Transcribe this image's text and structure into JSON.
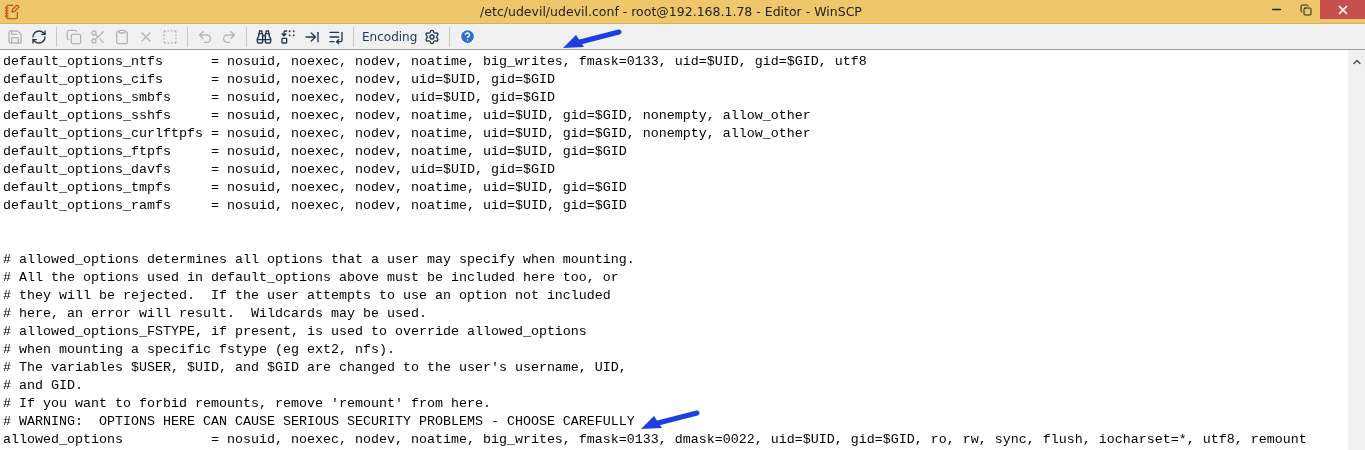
{
  "window": {
    "title": "/etc/udevil/udevil.conf - root@192.168.1.78 - Editor - WinSCP"
  },
  "toolbar": [
    {
      "kind": "save",
      "disabled": true
    },
    {
      "kind": "reload",
      "disabled": false
    },
    {
      "kind": "separator"
    },
    {
      "kind": "copy",
      "disabled": true
    },
    {
      "kind": "cut",
      "disabled": true
    },
    {
      "kind": "paste",
      "disabled": true
    },
    {
      "kind": "delete",
      "disabled": true
    },
    {
      "kind": "select_all",
      "disabled": true
    },
    {
      "kind": "separator"
    },
    {
      "kind": "undo",
      "disabled": true
    },
    {
      "kind": "redo",
      "disabled": true
    },
    {
      "kind": "separator"
    },
    {
      "kind": "find",
      "disabled": false
    },
    {
      "kind": "replace",
      "disabled": false
    },
    {
      "kind": "find_next",
      "disabled": false
    },
    {
      "kind": "goto_line",
      "disabled": false
    },
    {
      "kind": "separator"
    },
    {
      "kind": "text",
      "label": "Encoding",
      "disabled": false
    },
    {
      "kind": "settings",
      "disabled": false
    },
    {
      "kind": "separator"
    },
    {
      "kind": "help",
      "disabled": false
    }
  ],
  "editor": {
    "lines": [
      {
        "kind": "code",
        "text": "default_options_ntfs      = nosuid, noexec, nodev, noatime, big_writes, fmask=0133, uid=$UID, gid=$GID, utf8"
      },
      {
        "kind": "code",
        "text": "default_options_cifs      = nosuid, noexec, nodev, uid=$UID, gid=$GID"
      },
      {
        "kind": "code",
        "text": "default_options_smbfs     = nosuid, noexec, nodev, uid=$UID, gid=$GID"
      },
      {
        "kind": "code",
        "text": "default_options_sshfs     = nosuid, noexec, nodev, noatime, uid=$UID, gid=$GID, nonempty, allow_other"
      },
      {
        "kind": "code",
        "text": "default_options_curlftpfs = nosuid, noexec, nodev, noatime, uid=$UID, gid=$GID, nonempty, allow_other"
      },
      {
        "kind": "code",
        "text": "default_options_ftpfs     = nosuid, noexec, nodev, noatime, uid=$UID, gid=$GID"
      },
      {
        "kind": "code",
        "text": "default_options_davfs     = nosuid, noexec, nodev, uid=$UID, gid=$GID"
      },
      {
        "kind": "code",
        "text": "default_options_tmpfs     = nosuid, noexec, nodev, noatime, uid=$UID, gid=$GID"
      },
      {
        "kind": "code",
        "text": "default_options_ramfs     = nosuid, noexec, nodev, noatime, uid=$UID, gid=$GID"
      },
      {
        "kind": "blank"
      },
      {
        "kind": "blank"
      },
      {
        "kind": "code",
        "text": "# allowed_options determines all options that a user may specify when mounting."
      },
      {
        "kind": "code",
        "text": "# All the options used in default_options above must be included here too, or"
      },
      {
        "kind": "code",
        "text": "# they will be rejected.  If the user attempts to use an option not included"
      },
      {
        "kind": "code",
        "text": "# here, an error will result.  Wildcards may be used."
      },
      {
        "kind": "code",
        "text": "# allowed_options_FSTYPE, if present, is used to override allowed_options"
      },
      {
        "kind": "code",
        "text": "# when mounting a specific fstype (eg ext2, nfs)."
      },
      {
        "kind": "code",
        "text": "# The variables $USER, $UID, and $GID are changed to the user's username, UID,"
      },
      {
        "kind": "code",
        "text": "# and GID."
      },
      {
        "kind": "code",
        "text": "# If you want to forbid remounts, remove 'remount' from here."
      },
      {
        "kind": "code",
        "text": "# WARNING:  OPTIONS HERE CAN CAUSE SERIOUS SECURITY PROBLEMS - CHOOSE CAREFULLY"
      },
      {
        "kind": "code",
        "text": "allowed_options           = nosuid, noexec, nodev, noatime, big_writes, fmask=0133, dmask=0022, uid=$UID, gid=$GID, ro, rw, sync, flush, iocharset=*, utf8, remount"
      }
    ]
  }
}
